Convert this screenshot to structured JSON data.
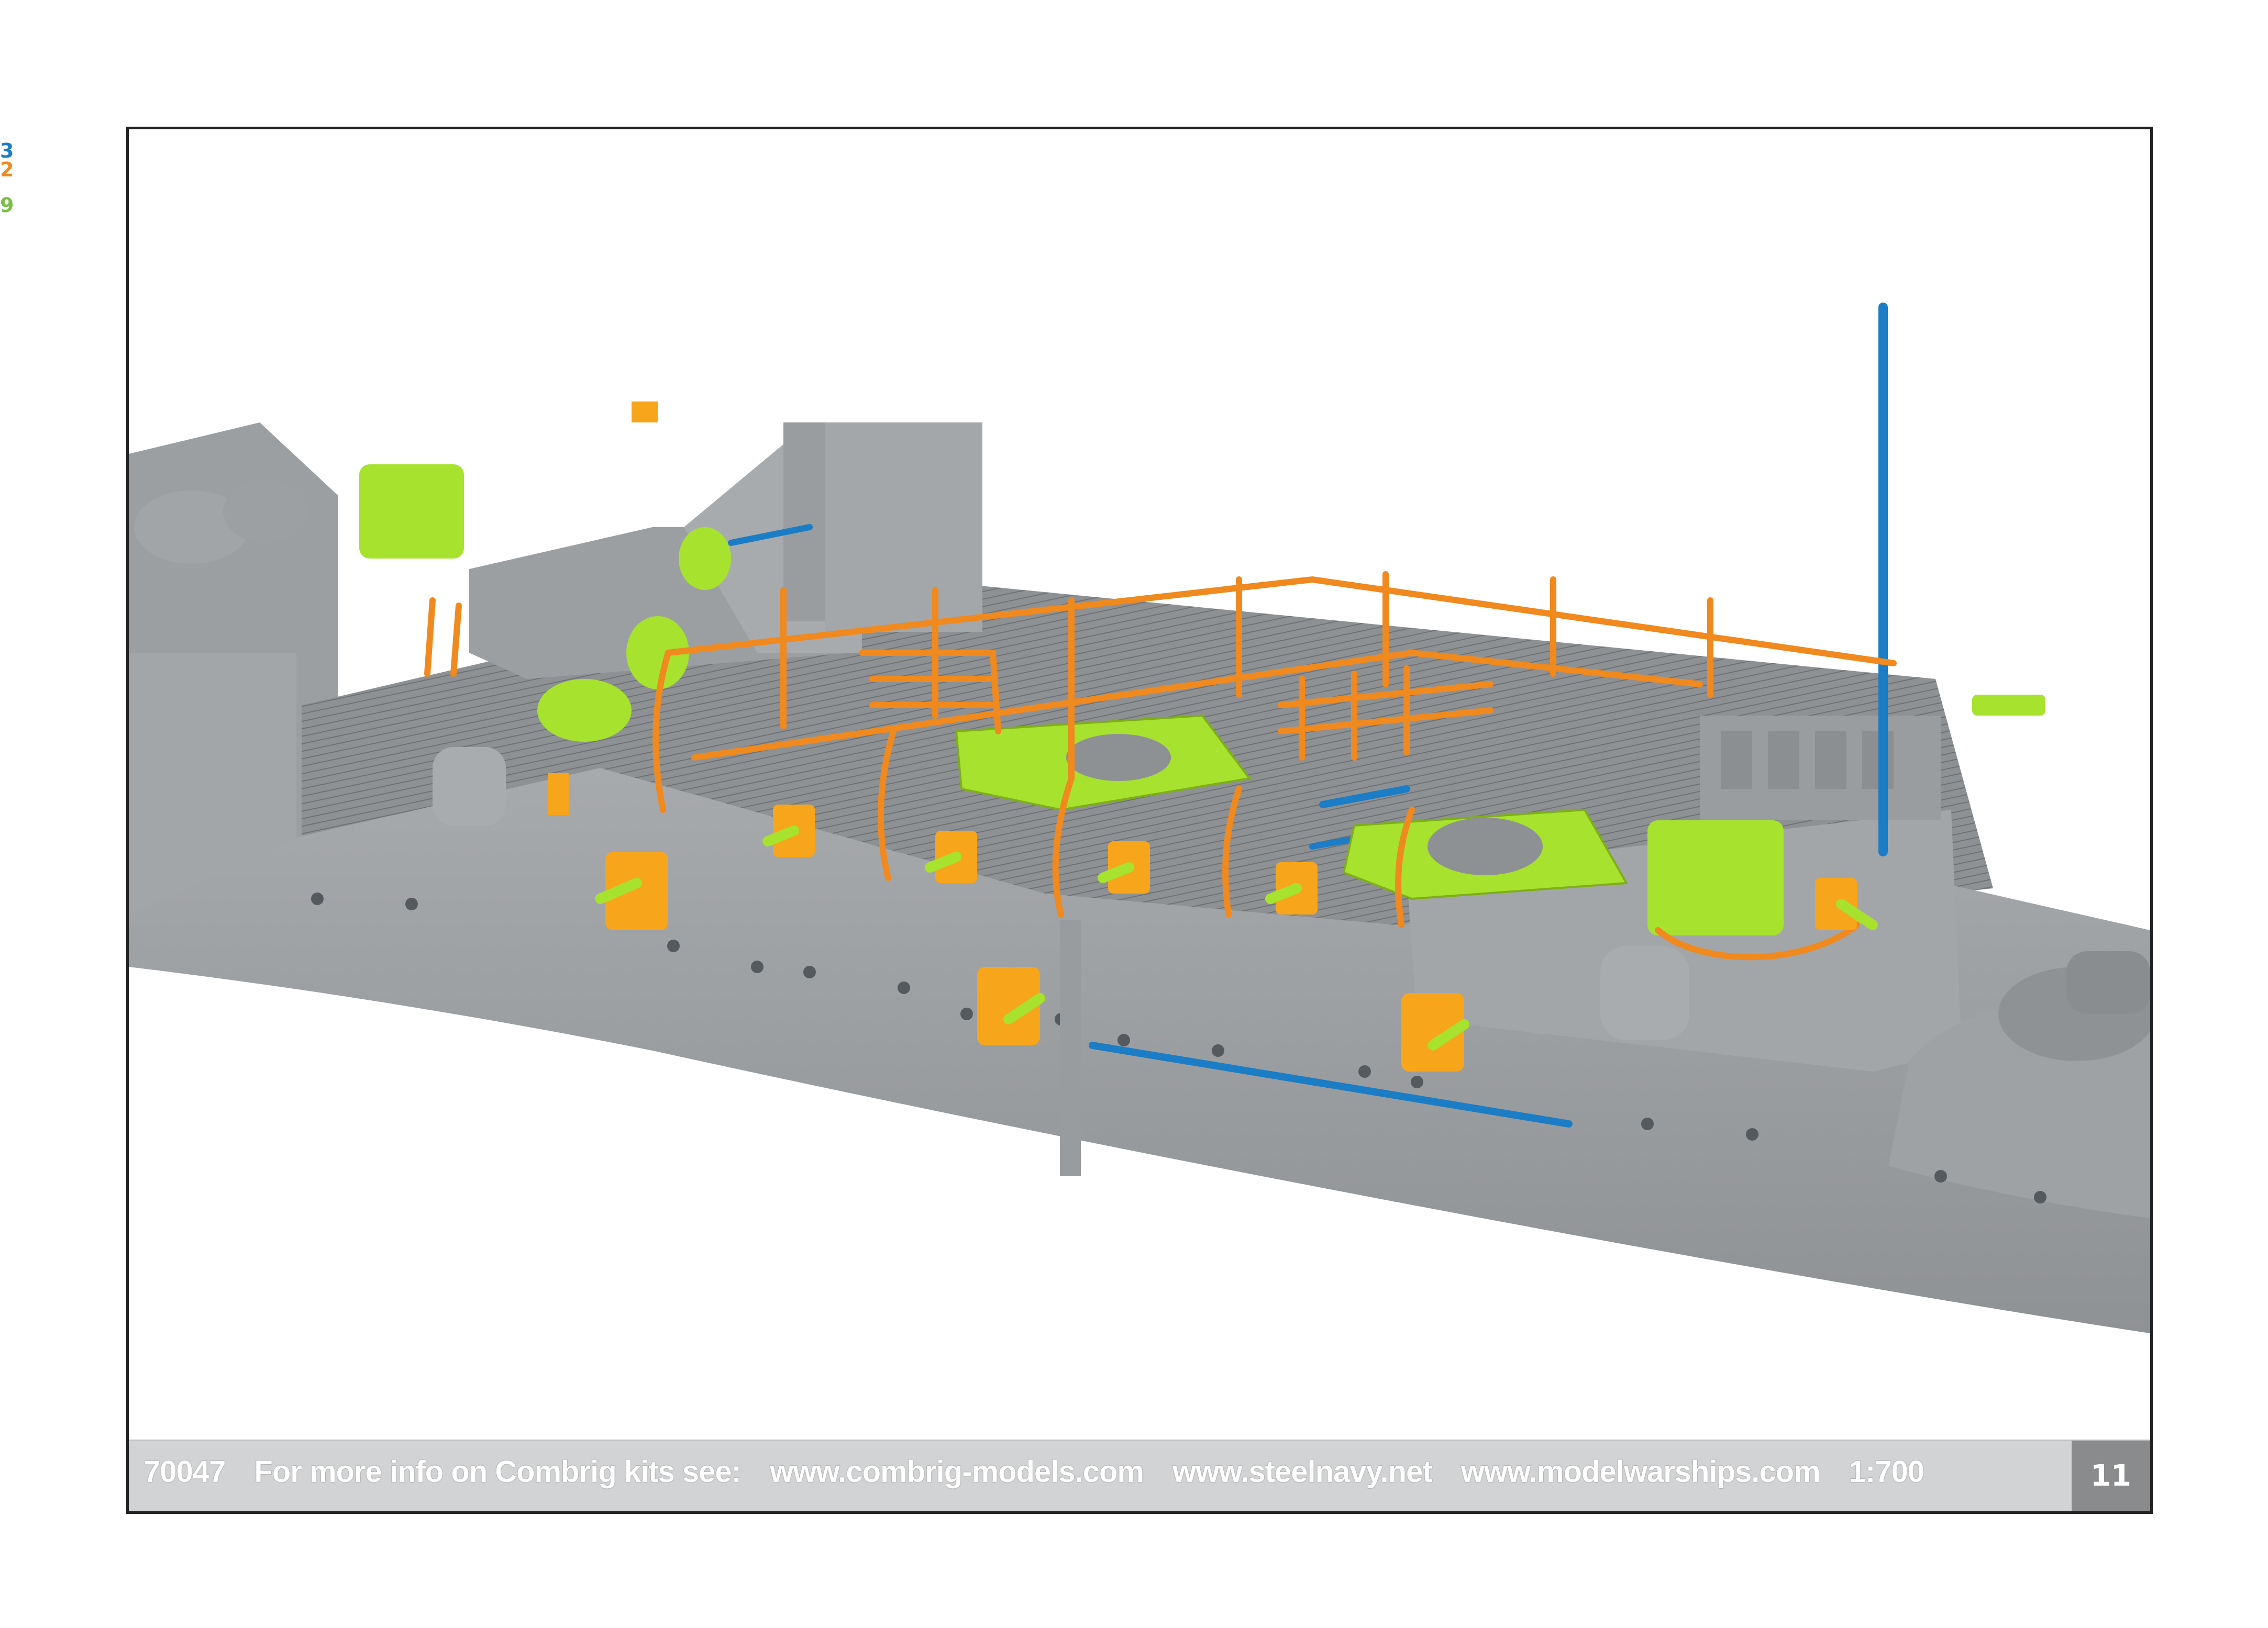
{
  "legend": {
    "blue_label": "3",
    "orange_label": "2",
    "green_label": "9",
    "colors": {
      "blue": "#1b7dc5",
      "orange": "#f0891e",
      "green": "#79c043"
    }
  },
  "illustration": {
    "hull_color": "#9a9da0",
    "deck_color": "#8b8e91",
    "photo_etch_color": "#f0891e",
    "resin_green_color": "#a6e22e",
    "rod_blue_color": "#1b7dc5"
  },
  "footer": {
    "kit_number": "70047",
    "info_text": "For more info on Combrig kits see:",
    "link_1": "www.combrig-models.com",
    "link_2": "www.steelnavy.net",
    "link_3": "www.modelwarships.com",
    "scale": "1:700",
    "page_number": "11"
  }
}
